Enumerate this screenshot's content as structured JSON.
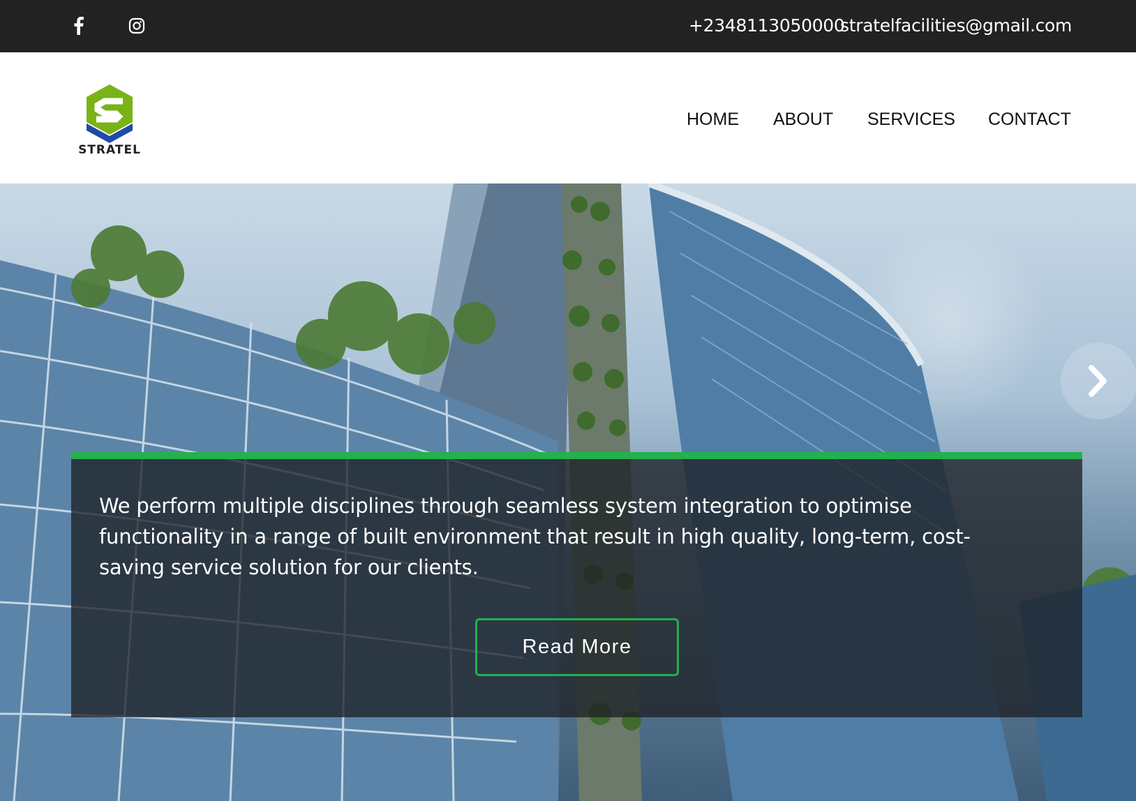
{
  "topbar": {
    "social": [
      {
        "name": "facebook-icon"
      },
      {
        "name": "instagram-icon"
      }
    ],
    "phone": "+2348113050000",
    "email": "stratelfacilities@gmail.com"
  },
  "header": {
    "logo_text": "STRATEL",
    "nav": {
      "home": "HOME",
      "about": "ABOUT",
      "services": "SERVICES",
      "contact": "CONTACT"
    }
  },
  "hero": {
    "caption": "We perform multiple disciplines through seamless system integration to optimise functionality in a range of built environment that result in high quality, long-term, cost-saving service solution for our clients.",
    "cta_label": "Read More",
    "next_icon": "chevron-right-icon"
  },
  "colors": {
    "topbar_bg": "#222222",
    "accent_green": "#22b14c",
    "logo_green": "#7ab317",
    "logo_blue": "#1f4aa8"
  }
}
